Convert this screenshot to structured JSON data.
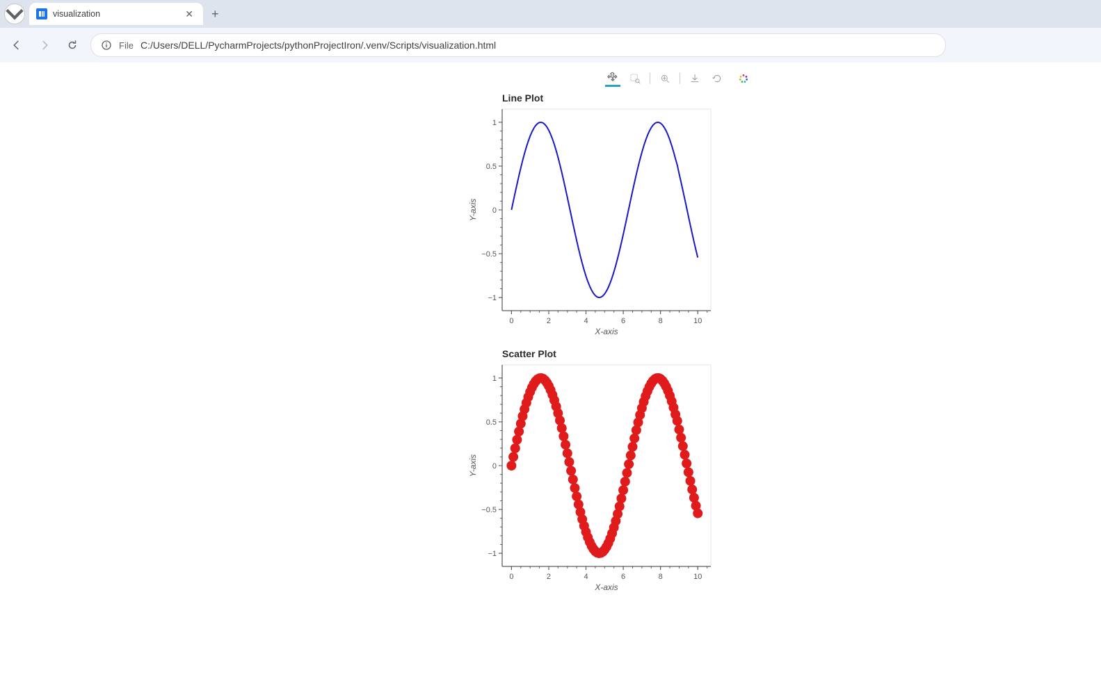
{
  "browser": {
    "tab_title": "visualization",
    "file_badge": "File",
    "url": "C:/Users/DELL/PycharmProjects/pythonProjectIron/.venv/Scripts/visualization.html"
  },
  "toolbar": {
    "tools": [
      {
        "name": "pan-tool",
        "active": true
      },
      {
        "name": "box-zoom-tool",
        "active": false
      },
      {
        "name": "wheel-zoom-tool",
        "active": false
      },
      {
        "name": "save-tool",
        "active": false
      },
      {
        "name": "reset-tool",
        "active": false
      },
      {
        "name": "bokeh-logo",
        "active": false
      }
    ]
  },
  "chart_data": [
    {
      "type": "line",
      "title": "Line Plot",
      "xlabel": "X-axis",
      "ylabel": "Y-axis",
      "xlim": [
        -0.5,
        10.7
      ],
      "ylim": [
        -1.15,
        1.15
      ],
      "xticks": [
        0,
        2,
        4,
        6,
        8,
        10
      ],
      "yticks": [
        -1,
        -0.5,
        0,
        0.5,
        1
      ],
      "x": [
        0.0,
        0.1,
        0.2,
        0.3,
        0.4,
        0.5,
        0.6,
        0.7,
        0.8,
        0.9,
        1.0,
        1.1,
        1.2,
        1.3,
        1.4,
        1.5,
        1.6,
        1.7,
        1.8,
        1.9,
        2.0,
        2.1,
        2.2,
        2.3,
        2.4,
        2.5,
        2.6,
        2.7,
        2.8,
        2.9,
        3.0,
        3.1,
        3.2,
        3.3,
        3.4,
        3.5,
        3.6,
        3.7,
        3.8,
        3.9,
        4.0,
        4.1,
        4.2,
        4.3,
        4.4,
        4.5,
        4.6,
        4.7,
        4.8,
        4.9,
        5.0,
        5.1,
        5.2,
        5.3,
        5.4,
        5.5,
        5.6,
        5.7,
        5.8,
        5.9,
        6.0,
        6.1,
        6.2,
        6.3,
        6.4,
        6.5,
        6.6,
        6.7,
        6.8,
        6.9,
        7.0,
        7.1,
        7.2,
        7.3,
        7.4,
        7.5,
        7.6,
        7.7,
        7.8,
        7.9,
        8.0,
        8.1,
        8.2,
        8.3,
        8.4,
        8.5,
        8.6,
        8.7,
        8.8,
        8.9,
        9.0,
        9.1,
        9.2,
        9.3,
        9.4,
        9.5,
        9.6,
        9.7,
        9.8,
        9.9,
        10.0
      ],
      "y": [
        0.0,
        0.0998,
        0.1987,
        0.2955,
        0.3894,
        0.4794,
        0.5646,
        0.6442,
        0.7174,
        0.7833,
        0.8415,
        0.8912,
        0.932,
        0.9636,
        0.9854,
        0.9975,
        0.9996,
        0.9917,
        0.9738,
        0.9463,
        0.9093,
        0.8632,
        0.8085,
        0.7457,
        0.6755,
        0.5985,
        0.5155,
        0.4274,
        0.335,
        0.2392,
        0.1411,
        0.0416,
        -0.0584,
        -0.1577,
        -0.2555,
        -0.3508,
        -0.4425,
        -0.5298,
        -0.6119,
        -0.6878,
        -0.7568,
        -0.8183,
        -0.8716,
        -0.9162,
        -0.9516,
        -0.9775,
        -0.9937,
        -0.9999,
        -0.9962,
        -0.9825,
        -0.9589,
        -0.9258,
        -0.8835,
        -0.8323,
        -0.7728,
        -0.7055,
        -0.6313,
        -0.5507,
        -0.4646,
        -0.3739,
        -0.2794,
        -0.1822,
        -0.0831,
        0.0168,
        0.1165,
        0.2151,
        0.3115,
        0.4048,
        0.4941,
        0.5784,
        0.657,
        0.729,
        0.7937,
        0.8504,
        0.8987,
        0.938,
        0.9679,
        0.9882,
        0.9985,
        0.9989,
        0.9894,
        0.97,
        0.9407,
        0.9022,
        0.8546,
        0.7985,
        0.7344,
        0.663,
        0.5849,
        0.511,
        0.4121,
        0.3191,
        0.2229,
        0.1245,
        0.0248,
        -0.0752,
        -0.1743,
        -0.2718,
        -0.3665,
        -0.4575,
        -0.544
      ],
      "color": "#1818c8"
    },
    {
      "type": "scatter",
      "title": "Scatter Plot",
      "xlabel": "X-axis",
      "ylabel": "Y-axis",
      "xlim": [
        -0.5,
        10.7
      ],
      "ylim": [
        -1.15,
        1.15
      ],
      "xticks": [
        0,
        2,
        4,
        6,
        8,
        10
      ],
      "yticks": [
        -1,
        -0.5,
        0,
        0.5,
        1
      ],
      "x": [
        0.0,
        0.1,
        0.2,
        0.3,
        0.4,
        0.5,
        0.6,
        0.7,
        0.8,
        0.9,
        1.0,
        1.1,
        1.2,
        1.3,
        1.4,
        1.5,
        1.6,
        1.7,
        1.8,
        1.9,
        2.0,
        2.1,
        2.2,
        2.3,
        2.4,
        2.5,
        2.6,
        2.7,
        2.8,
        2.9,
        3.0,
        3.1,
        3.2,
        3.3,
        3.4,
        3.5,
        3.6,
        3.7,
        3.8,
        3.9,
        4.0,
        4.1,
        4.2,
        4.3,
        4.4,
        4.5,
        4.6,
        4.7,
        4.8,
        4.9,
        5.0,
        5.1,
        5.2,
        5.3,
        5.4,
        5.5,
        5.6,
        5.7,
        5.8,
        5.9,
        6.0,
        6.1,
        6.2,
        6.3,
        6.4,
        6.5,
        6.6,
        6.7,
        6.8,
        6.9,
        7.0,
        7.1,
        7.2,
        7.3,
        7.4,
        7.5,
        7.6,
        7.7,
        7.8,
        7.9,
        8.0,
        8.1,
        8.2,
        8.3,
        8.4,
        8.5,
        8.6,
        8.7,
        8.8,
        8.9,
        9.0,
        9.1,
        9.2,
        9.3,
        9.4,
        9.5,
        9.6,
        9.7,
        9.8,
        9.9,
        10.0
      ],
      "y": [
        0.0,
        0.0998,
        0.1987,
        0.2955,
        0.3894,
        0.4794,
        0.5646,
        0.6442,
        0.7174,
        0.7833,
        0.8415,
        0.8912,
        0.932,
        0.9636,
        0.9854,
        0.9975,
        0.9996,
        0.9917,
        0.9738,
        0.9463,
        0.9093,
        0.8632,
        0.8085,
        0.7457,
        0.6755,
        0.5985,
        0.5155,
        0.4274,
        0.335,
        0.2392,
        0.1411,
        0.0416,
        -0.0584,
        -0.1577,
        -0.2555,
        -0.3508,
        -0.4425,
        -0.5298,
        -0.6119,
        -0.6878,
        -0.7568,
        -0.8183,
        -0.8716,
        -0.9162,
        -0.9516,
        -0.9775,
        -0.9937,
        -0.9999,
        -0.9962,
        -0.9825,
        -0.9589,
        -0.9258,
        -0.8835,
        -0.8323,
        -0.7728,
        -0.7055,
        -0.6313,
        -0.5507,
        -0.4646,
        -0.3739,
        -0.2794,
        -0.1822,
        -0.0831,
        0.0168,
        0.1165,
        0.2151,
        0.3115,
        0.4048,
        0.4941,
        0.5784,
        0.657,
        0.729,
        0.7937,
        0.8504,
        0.8987,
        0.938,
        0.9679,
        0.9882,
        0.9985,
        0.9989,
        0.9894,
        0.97,
        0.9407,
        0.9022,
        0.8546,
        0.7985,
        0.7344,
        0.663,
        0.5849,
        0.511,
        0.4121,
        0.3191,
        0.2229,
        0.1245,
        0.0248,
        -0.0752,
        -0.1743,
        -0.2718,
        -0.3665,
        -0.4575,
        -0.544
      ],
      "color": "#e01b1b",
      "marker_radius": 7
    }
  ]
}
